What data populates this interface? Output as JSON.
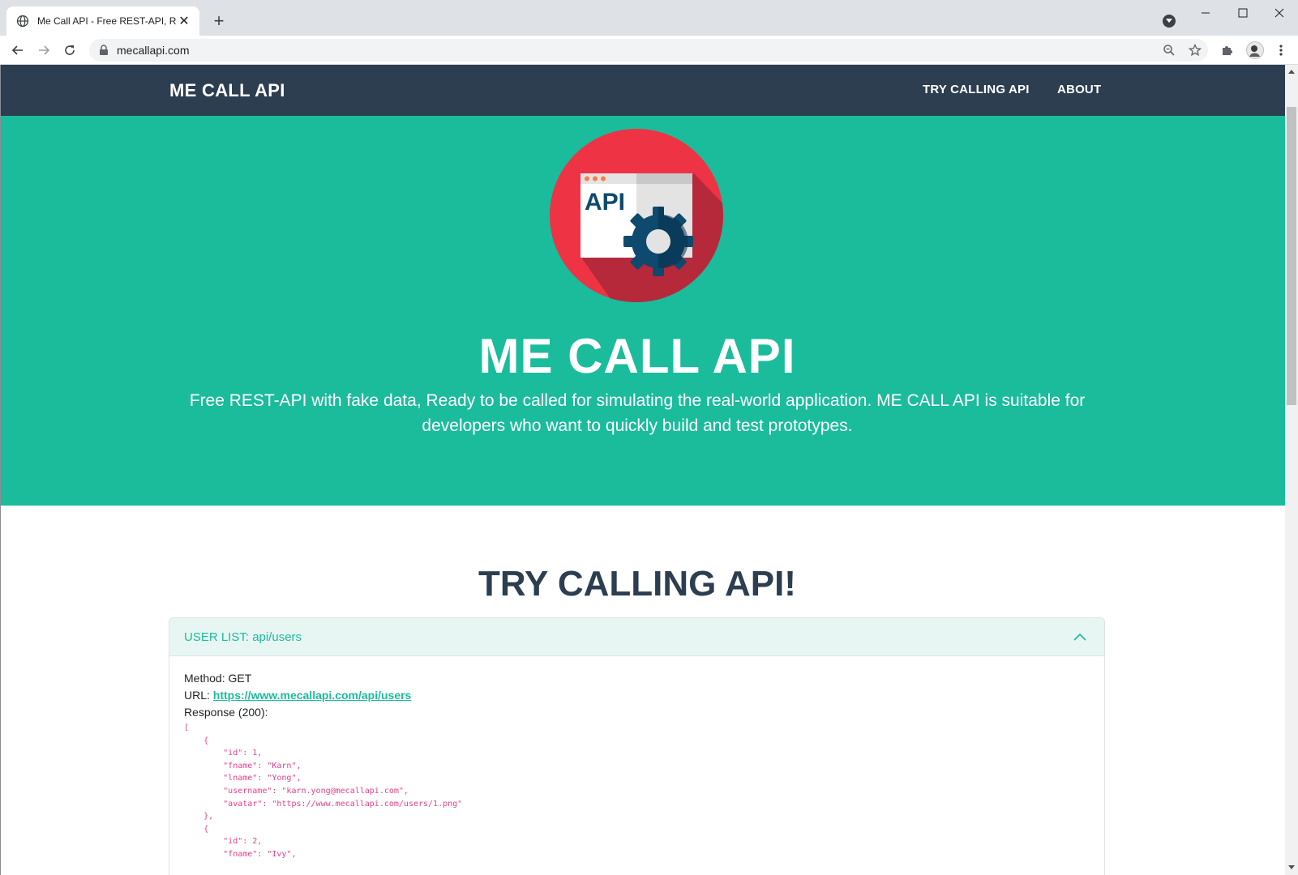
{
  "browser": {
    "tab_title": "Me Call API - Free REST-API, Rea",
    "url": "mecallapi.com",
    "icons": [
      "globe-icon",
      "close-icon",
      "plus-icon",
      "back-icon",
      "forward-icon",
      "reload-icon",
      "lock-icon",
      "zoom-icon",
      "star-icon",
      "puzzle-icon",
      "avatar",
      "menu-icon"
    ]
  },
  "nav": {
    "brand": "ME CALL API",
    "links": [
      "TRY CALLING API",
      "ABOUT"
    ]
  },
  "hero": {
    "logo_text": "API",
    "title": "ME CALL API",
    "description": "Free REST-API with fake data, Ready to be called for simulating the real-world application. ME CALL API is suitable for developers who want to quickly build and test prototypes."
  },
  "section": {
    "title": "TRY CALLING API!"
  },
  "card": {
    "header": "USER LIST: api/users",
    "method_label": "Method: GET",
    "url_label": "URL:",
    "url_link": "https://www.mecallapi.com/api/users",
    "response_label": "Response (200):",
    "response_code": "[\n    {\n        \"id\": 1,\n        \"fname\": \"Karn\",\n        \"lname\": \"Yong\",\n        \"username\": \"karn.yong@mecallapi.com\",\n        \"avatar\": \"https://www.mecallapi.com/users/1.png\"\n    },\n    {\n        \"id\": 2,\n        \"fname\": \"Ivy\","
  },
  "colors": {
    "navbar": "#2c3e50",
    "hero": "#1abc9c",
    "accent": "#1abc9c",
    "code": "#e83e8c",
    "logo_red": "#ee3344",
    "logo_shadow": "#b5293b",
    "gear_blue": "#0e4a6e"
  }
}
